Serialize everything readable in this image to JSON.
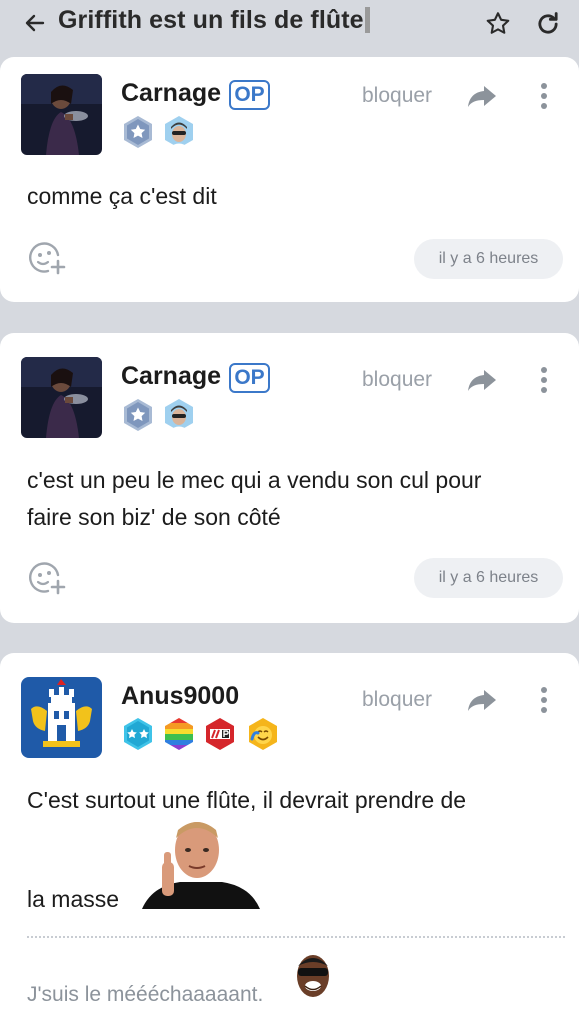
{
  "topbar": {
    "title": "Griffith est un fils de flûte",
    "back_icon": "arrow-left-icon",
    "favorite_icon": "star-outline-icon",
    "refresh_icon": "refresh-icon"
  },
  "posts": [
    {
      "username": "Carnage",
      "op_label": "OP",
      "block_label": "bloquer",
      "badges": [
        "star-badge-icon",
        "sunglasses-man-badge-icon"
      ],
      "text": "comme ça c'est dit",
      "time": "il y a 6 heures"
    },
    {
      "username": "Carnage",
      "op_label": "OP",
      "block_label": "bloquer",
      "badges": [
        "star-badge-icon",
        "sunglasses-man-badge-icon"
      ],
      "text_line1": "c'est un peu le mec qui a vendu son cul pour",
      "text_line2": "faire son biz' de son côté",
      "time": "il y a 6 heures"
    },
    {
      "username": "Anus9000",
      "block_label": "bloquer",
      "badges": [
        "two-stars-badge-icon",
        "rainbow-badge-icon",
        "hype-p-badge-icon",
        "smiley-badge-icon"
      ],
      "text_line1": "C'est surtout une flûte, il devrait prendre de",
      "text_line2": "la masse",
      "signature": "J'suis le méééchaaaaant."
    }
  ],
  "colors": {
    "background": "#d6d9df",
    "card": "#ffffff",
    "accent_op": "#3b78c9",
    "muted_text": "#9aa0a8"
  }
}
